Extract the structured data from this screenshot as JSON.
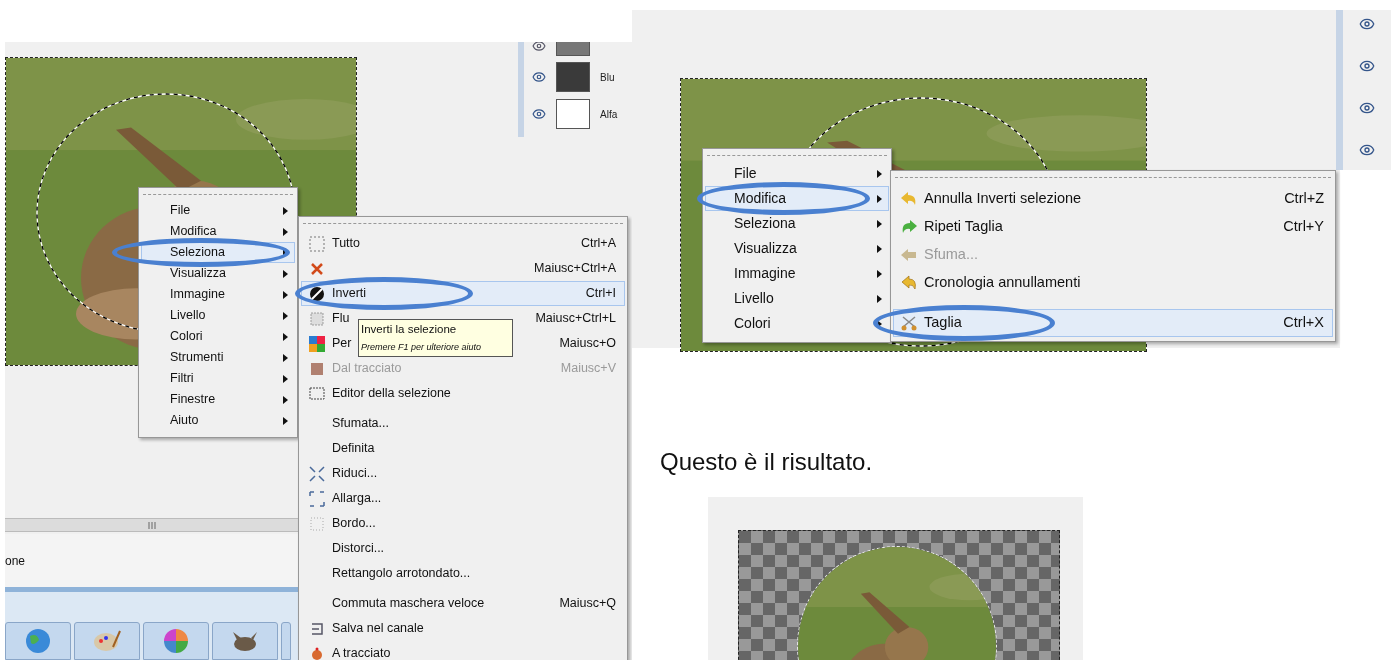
{
  "screenshot_1": {
    "channels": [
      {
        "name": "Blu"
      },
      {
        "name": "Alfa"
      }
    ],
    "status_text": "one",
    "menu": [
      {
        "label": "File",
        "selected": false,
        "circled": false
      },
      {
        "label": "Modifica",
        "selected": false,
        "circled": false
      },
      {
        "label": "Seleziona",
        "selected": true,
        "circled": true
      },
      {
        "label": "Visualizza",
        "selected": false,
        "circled": false
      },
      {
        "label": "Immagine",
        "selected": false,
        "circled": false
      },
      {
        "label": "Livello",
        "selected": false,
        "circled": false
      },
      {
        "label": "Colori",
        "selected": false,
        "circled": false
      },
      {
        "label": "Strumenti",
        "selected": false,
        "circled": false
      },
      {
        "label": "Filtri",
        "selected": false,
        "circled": false
      },
      {
        "label": "Finestre",
        "selected": false,
        "circled": false
      },
      {
        "label": "Aiuto",
        "selected": false,
        "circled": false
      }
    ],
    "submenu": [
      {
        "kind": "item",
        "label": "Tutto",
        "shortcut": "Ctrl+A",
        "disabled": false,
        "selected": false,
        "circled": false
      },
      {
        "kind": "item",
        "shortcut": "Maiusc+Ctrl+A",
        "disabled": false,
        "selected": false,
        "circled": false
      },
      {
        "kind": "item",
        "label": "Inverti",
        "shortcut": "Ctrl+I",
        "disabled": false,
        "selected": true,
        "circled": true
      },
      {
        "kind": "item",
        "label": "Flu",
        "shortcut": "Maiusc+Ctrl+L",
        "disabled": false,
        "selected": false,
        "circled": false
      },
      {
        "kind": "item",
        "label": "Per",
        "shortcut": "Maiusc+O",
        "disabled": false,
        "selected": false,
        "circled": false
      },
      {
        "kind": "item",
        "label": "Dal tracciato",
        "shortcut": "Maiusc+V",
        "disabled": true,
        "selected": false,
        "circled": false
      },
      {
        "kind": "item",
        "label": "Editor della selezione",
        "disabled": false,
        "selected": false,
        "circled": false
      },
      {
        "kind": "spacer"
      },
      {
        "kind": "item",
        "label": "Sfumata...",
        "disabled": false,
        "selected": false,
        "circled": false
      },
      {
        "kind": "item",
        "label": "Definita",
        "disabled": false,
        "selected": false,
        "circled": false
      },
      {
        "kind": "item",
        "label": "Riduci...",
        "disabled": false,
        "selected": false,
        "circled": false
      },
      {
        "kind": "item",
        "label": "Allarga...",
        "disabled": false,
        "selected": false,
        "circled": false
      },
      {
        "kind": "item",
        "label": "Bordo...",
        "disabled": false,
        "selected": false,
        "circled": false
      },
      {
        "kind": "item",
        "label": "Distorci...",
        "disabled": false,
        "selected": false,
        "circled": false
      },
      {
        "kind": "item",
        "label": "Rettangolo arrotondato...",
        "disabled": false,
        "selected": false,
        "circled": false
      },
      {
        "kind": "spacer"
      },
      {
        "kind": "item",
        "label": "Commuta maschera veloce",
        "shortcut": "Maiusc+Q",
        "disabled": false,
        "selected": false,
        "circled": false
      },
      {
        "kind": "item",
        "label": "Salva nel canale",
        "disabled": false,
        "selected": false,
        "circled": false
      },
      {
        "kind": "item",
        "label": "A tracciato",
        "disabled": false,
        "selected": false,
        "circled": false
      }
    ],
    "tooltip": {
      "title": "Inverti la selezione",
      "hint": "Premere F1 per ulteriore aiuto"
    }
  },
  "screenshot_2": {
    "menu": [
      {
        "label": "File",
        "selected": false,
        "circled": false
      },
      {
        "label": "Modifica",
        "selected": true,
        "circled": true
      },
      {
        "label": "Seleziona",
        "selected": false,
        "circled": false
      },
      {
        "label": "Visualizza",
        "selected": false,
        "circled": false
      },
      {
        "label": "Immagine",
        "selected": false,
        "circled": false
      },
      {
        "label": "Livello",
        "selected": false,
        "circled": false
      },
      {
        "label": "Colori",
        "selected": false,
        "circled": false
      }
    ],
    "submenu": [
      {
        "kind": "item",
        "label": "Annulla Inverti selezione",
        "shortcut": "Ctrl+Z",
        "disabled": false,
        "selected": false,
        "circled": false
      },
      {
        "kind": "item",
        "label": "Ripeti Taglia",
        "shortcut": "Ctrl+Y",
        "disabled": false,
        "selected": false,
        "circled": false
      },
      {
        "kind": "item",
        "label": "Sfuma...",
        "disabled": true,
        "selected": false,
        "circled": false
      },
      {
        "kind": "item",
        "label": "Cronologia annullamenti",
        "disabled": false,
        "selected": false,
        "circled": false
      },
      {
        "kind": "spacer"
      },
      {
        "kind": "item",
        "label": "Taglia",
        "shortcut": "Ctrl+X",
        "disabled": false,
        "selected": true,
        "circled": true
      }
    ]
  },
  "caption": "Questo è il risultato."
}
